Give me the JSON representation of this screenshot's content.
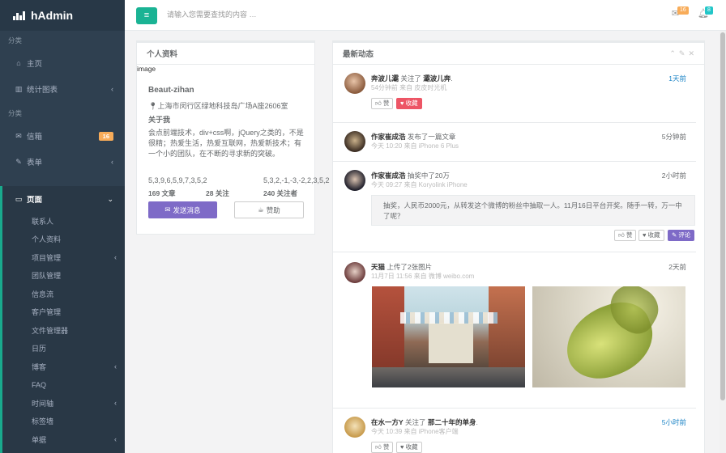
{
  "app": {
    "name": "hAdmin"
  },
  "sidebar": {
    "section1": "分类",
    "section2": "分类",
    "items": [
      {
        "label": "主页",
        "icon": "home-icon"
      },
      {
        "label": "统计图表",
        "icon": "bar-chart-icon"
      },
      {
        "label": "信箱",
        "icon": "envelope-icon",
        "badge": "16"
      },
      {
        "label": "表单",
        "icon": "edit-icon"
      },
      {
        "label": "页面",
        "icon": "desktop-icon"
      }
    ],
    "subitems": [
      "联系人",
      "个人资料",
      "项目管理",
      "团队管理",
      "信息流",
      "客户管理",
      "文件管理器",
      "日历",
      "博客",
      "FAQ",
      "时间轴",
      "标签墙",
      "单据"
    ]
  },
  "topbar": {
    "search_placeholder": "请输入您需要查找的内容 …",
    "mail_badge": "16",
    "bell_badge": "8"
  },
  "profile": {
    "title": "个人资料",
    "image_alt": "image",
    "name": "Beaut-zihan",
    "address": "上海市闵行区绿地科技岛广场A座2606室",
    "about_label": "关于我",
    "about_text": "会点前端技术，div+css啊，jQuery之类的，不是很精；热爱生活，热爱互联网，热爱新技术；有一个小的团队，在不断的寻求新的突破。",
    "stats": [
      {
        "spark": "5,3,9,6,5,9,7,3,5,2",
        "label": "169 文章"
      },
      {
        "spark": "",
        "label": "28 关注"
      },
      {
        "spark": "5,3,2,-1,-3,-2,2,3,5,2",
        "label": "240 关注者"
      }
    ],
    "send_button": "发送消息",
    "like_button": "赞助"
  },
  "feed": {
    "title": "最新动态",
    "items": [
      {
        "user": "奔波儿灞",
        "action": "关注了",
        "target": "灞波儿奔",
        "meta": "54分钟前 来自 皮皮时光机",
        "time": "1天前",
        "time_color": "blue",
        "buttons": [
          "赞",
          "收藏"
        ]
      },
      {
        "user": "作家崔成浩",
        "action": "发布了一篇文章",
        "target": "",
        "meta": "今天 10:20 来自 iPhone 6 Plus",
        "time": "5分钟前",
        "time_color": "default"
      },
      {
        "user": "作家崔成浩",
        "action": "抽奖中了20万",
        "target": "",
        "meta": "今天 09:27 来自 Koryolink iPhone",
        "time": "2小时前",
        "time_color": "default",
        "quote": "抽奖，人民币2000元，从转发这个微博的粉丝中抽取一人。11月16日平台开奖。随手一转，万一中了呢？",
        "buttons": [
          "赞",
          "收藏",
          "评论"
        ]
      },
      {
        "user": "天猫",
        "action": "上传了2张图片",
        "target": "",
        "meta": "11月7日 11:56 来自 微博 weibo.com",
        "time": "2天前",
        "time_color": "default"
      },
      {
        "user": "在水一方Y",
        "action": "关注了",
        "target": "那二十年的单身",
        "meta": "今天 10:39 来自 iPhone客户端",
        "time": "5小时前",
        "time_color": "blue",
        "buttons": [
          "赞",
          "收藏"
        ]
      }
    ]
  },
  "colors": {
    "sidebar": "#2f4050",
    "accent": "#1ab394",
    "purple": "#7e6ac7",
    "red": "#ed5565",
    "orange": "#f8ac59",
    "blue": "#1c84c6"
  }
}
